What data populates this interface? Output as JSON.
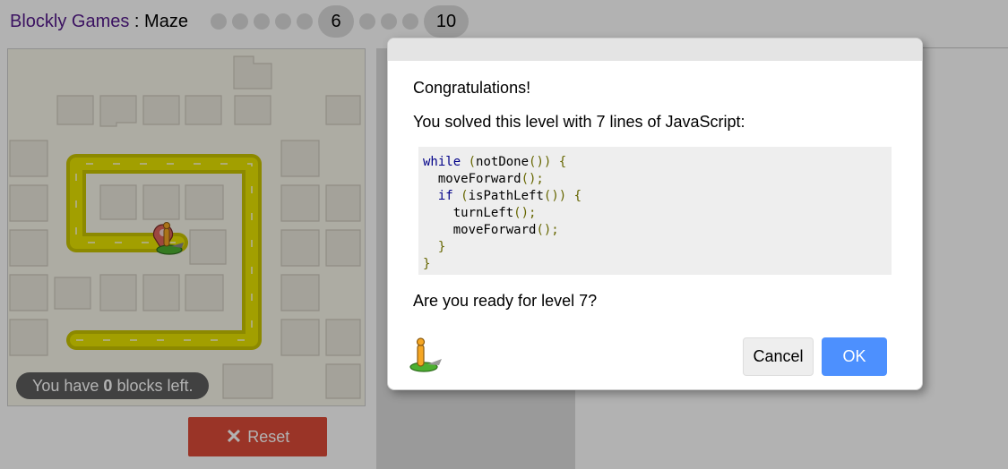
{
  "header": {
    "brand": "Blockly Games",
    "separator": " : ",
    "game": "Maze",
    "levels_before_current": 5,
    "current_level": "6",
    "levels_between": 3,
    "max_level": "10"
  },
  "maze": {
    "blocks_left_prefix": "You have ",
    "blocks_left_count": "0",
    "blocks_left_suffix": " blocks left."
  },
  "reset": {
    "icon": "close-x-icon",
    "label": "Reset",
    "color": "#dd4b39"
  },
  "dialog": {
    "congrats": "Congratulations!",
    "solved": "You solved this level with 7 lines of JavaScript:",
    "code_lines": [
      "while (notDone()) {",
      "  moveForward();",
      "  if (isPathLeft()) {",
      "    turnLeft();",
      "    moveForward();",
      "  }",
      "}"
    ],
    "ready": "Are you ready for level 7?",
    "cancel_label": "Cancel",
    "ok_label": "OK",
    "ok_color": "#4d90fe"
  }
}
